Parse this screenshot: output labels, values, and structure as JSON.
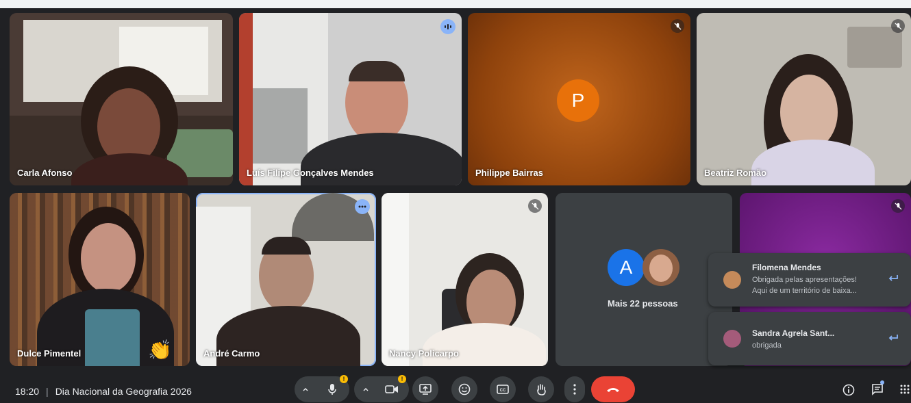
{
  "participants": [
    {
      "name": "Carla Afonso",
      "state": "camera"
    },
    {
      "name": "Luís Filipe Gonçalves Mendes",
      "state": "speaking"
    },
    {
      "name": "Philippe Bairras",
      "state": "muted",
      "avatar_letter": "P",
      "color": "#e8710a"
    },
    {
      "name": "Beatriz Romão",
      "state": "muted"
    },
    {
      "name": "Dulce Pimentel",
      "state": "camera",
      "reaction": "👏"
    },
    {
      "name": "André Carmo",
      "state": "pinned-more"
    },
    {
      "name": "Nancy Policarpo",
      "state": "muted"
    }
  ],
  "others_tile": {
    "avatar_letter": "A",
    "avatar_color": "#1a73e8",
    "label": "Mais 22 pessoas"
  },
  "notifications": [
    {
      "sender": "Filomena Mendes",
      "line1": "Obrigada pelas apresentações!",
      "line2": "Aqui de um território de baixa..."
    },
    {
      "sender": "Sandra Agrela Sant...",
      "line1": "obrigada"
    }
  ],
  "bottom_bar": {
    "time": "18:20",
    "meeting_title": "Dia Nacional da Geografia 2026"
  },
  "colors": {
    "background": "#202124",
    "accent": "#8ab4f8",
    "end_call": "#ea4335",
    "warning": "#fbbc04"
  },
  "icons": [
    "chevron-up-icon",
    "mic-icon",
    "camera-icon",
    "present-icon",
    "emoji-icon",
    "captions-icon",
    "raise-hand-icon",
    "more-options-icon",
    "end-call-icon",
    "info-icon",
    "chat-icon",
    "activities-icon",
    "muted-mic-icon",
    "reply-icon"
  ]
}
